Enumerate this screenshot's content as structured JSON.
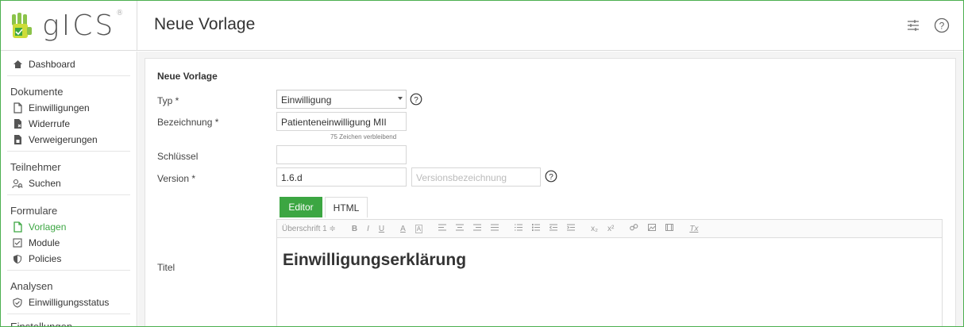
{
  "brand": {
    "name": "gICS",
    "reg": "®"
  },
  "header": {
    "title": "Neue Vorlage"
  },
  "sidebar": {
    "dashboard": "Dashboard",
    "sections": [
      {
        "heading": "Dokumente",
        "items": [
          "Einwilligungen",
          "Widerrufe",
          "Verweigerungen"
        ]
      },
      {
        "heading": "Teilnehmer",
        "items": [
          "Suchen"
        ]
      },
      {
        "heading": "Formulare",
        "items": [
          "Vorlagen",
          "Module",
          "Policies"
        ]
      },
      {
        "heading": "Analysen",
        "items": [
          "Einwilligungsstatus"
        ]
      },
      {
        "heading": "Einstellungen",
        "items": []
      }
    ]
  },
  "form": {
    "title": "Neue Vorlage",
    "typ": {
      "label": "Typ *",
      "value": "Einwilligung"
    },
    "bezeichnung": {
      "label": "Bezeichnung *",
      "value": "Patienteneinwilligung MII",
      "hint": "75 Zeichen verbleibend"
    },
    "schluessel": {
      "label": "Schlüssel",
      "value": ""
    },
    "version": {
      "label": "Version *",
      "value": "1.6.d",
      "placeholder": "Versionsbezeichnung"
    },
    "titel": {
      "label": "Titel"
    }
  },
  "editor": {
    "tabs": [
      "Editor",
      "HTML"
    ],
    "heading_select": "Überschrift 1 ≑",
    "toolbar": {
      "bold": "B",
      "italic": "I",
      "underline": "U",
      "color": "A",
      "bg": "A",
      "sub": "x₂",
      "sup": "x²",
      "clear": "Tx"
    },
    "content": "Einwilligungserklärung"
  },
  "colors": {
    "accent": "#3ca642",
    "border": "#4caf50"
  }
}
